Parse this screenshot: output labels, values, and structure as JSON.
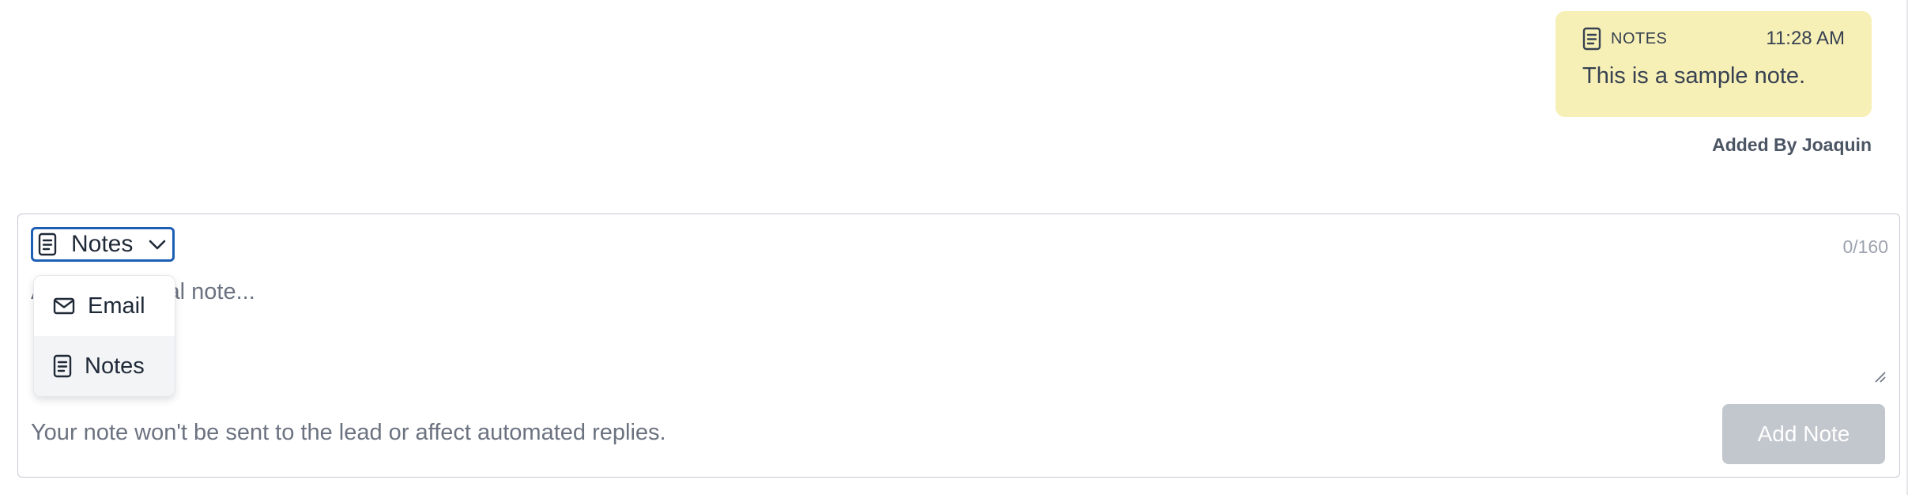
{
  "note": {
    "tag_label": "NOTES",
    "tag_icon": "note-icon",
    "time": "11:28 AM",
    "text": "This is a sample note.",
    "added_by": "Added By Joaquin",
    "background_color": "#f7f0b6"
  },
  "composer": {
    "type_select": {
      "selected_label": "Notes",
      "icon": "note-icon",
      "chevron_icon": "chevron-down-icon",
      "focus_color": "#1d5fb4"
    },
    "char_count": "0/160",
    "input": {
      "value": "",
      "placeholder": "Add an internal note..."
    },
    "helper_text": "Your note won't be sent to the lead or affect automated replies.",
    "submit_label": "Add Note",
    "submit_disabled_color": "#c2c6cd"
  },
  "dropdown": {
    "items": [
      {
        "label": "Email",
        "icon": "mail-icon"
      },
      {
        "label": "Notes",
        "icon": "note-icon"
      }
    ]
  }
}
